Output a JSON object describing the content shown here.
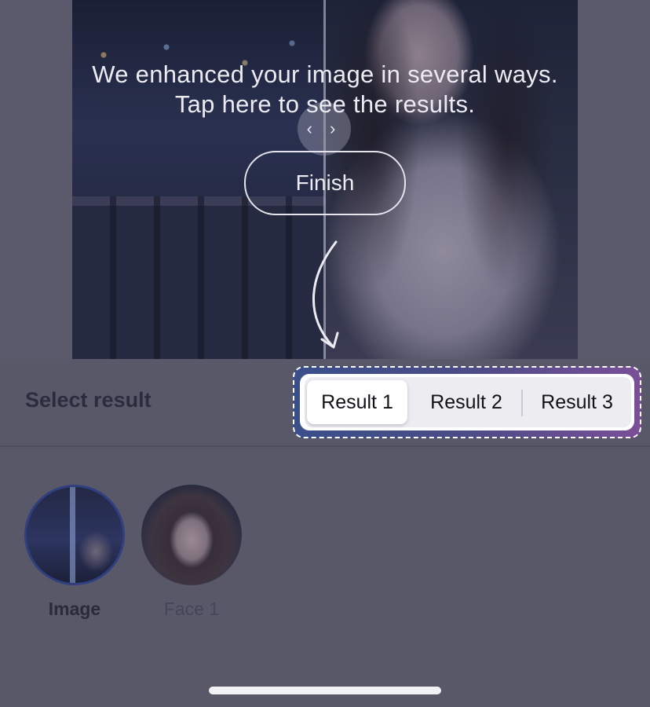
{
  "overlay": {
    "headline": "We enhanced your image in several ways. Tap here to see the results.",
    "finish_label": "Finish",
    "compare_handle": "‹ ›"
  },
  "results": {
    "title": "Select result",
    "tabs": [
      "Result 1",
      "Result 2",
      "Result 3"
    ],
    "selected": "Result 1"
  },
  "thumbnails": [
    {
      "label": "Image",
      "selected": true
    },
    {
      "label": "Face 1",
      "selected": false
    }
  ],
  "colors": {
    "overlay_bg": "#5a5a6c",
    "highlight_gradient_start": "#3a4f8a",
    "highlight_gradient_end": "#7a4f98",
    "selected_ring": "#2f3f80"
  }
}
